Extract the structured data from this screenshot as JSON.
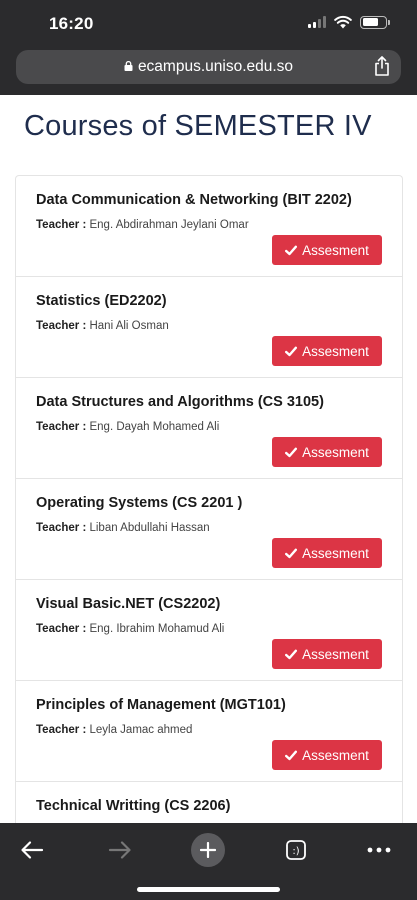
{
  "status": {
    "time": "16:20"
  },
  "browser": {
    "url": "ecampus.uniso.edu.so"
  },
  "page": {
    "title": "Courses of SEMESTER IV"
  },
  "teacher_label": "Teacher :",
  "courses": [
    {
      "name": "Data Communication & Networking (BIT 2202)",
      "teacher": "Eng. Abdirahman Jeylani Omar",
      "button": "Assesment"
    },
    {
      "name": "Statistics (ED2202)",
      "teacher": "Hani Ali Osman",
      "button": "Assesment"
    },
    {
      "name": "Data Structures and Algorithms (CS 3105)",
      "teacher": "Eng. Dayah Mohamed Ali",
      "button": "Assesment"
    },
    {
      "name": "Operating Systems (CS 2201 )",
      "teacher": "Liban Abdullahi Hassan",
      "button": "Assesment"
    },
    {
      "name": "Visual Basic.NET (CS2202)",
      "teacher": "Eng. Ibrahim Mohamud Ali",
      "button": "Assesment"
    },
    {
      "name": "Principles of Management (MGT101)",
      "teacher": "Leyla Jamac ahmed",
      "button": "Assesment"
    },
    {
      "name": "Technical Writting (CS 2206)"
    }
  ],
  "colors": {
    "chrome": "#2b2b2d",
    "title": "#1f2d4d",
    "button": "#dc3545"
  },
  "icons": {
    "lock": "lock-icon",
    "share": "share-icon",
    "check": "check-icon",
    "back": "back-arrow-icon",
    "forward": "forward-arrow-icon",
    "new_tab": "plus-icon",
    "tabs": "tabs-icon",
    "more": "more-icon"
  }
}
